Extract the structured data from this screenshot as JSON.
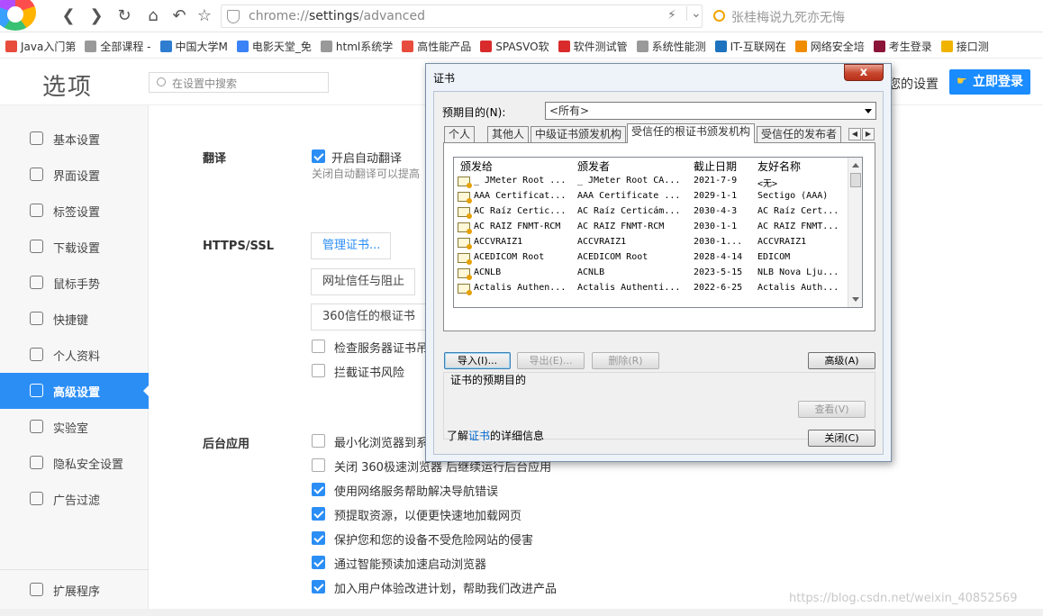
{
  "browser": {
    "url_prefix": "chrome://",
    "url_main": "settings",
    "url_suffix": "/advanced",
    "search_placeholder": "张桂梅说九死亦无悔",
    "bookmarks": [
      {
        "label": "Java入门第",
        "color": "#e84c3d"
      },
      {
        "label": "全部课程 -",
        "color": "#999999"
      },
      {
        "label": "中国大学M",
        "color": "#2e7dd1"
      },
      {
        "label": "电影天堂_免",
        "color": "#3b82f6"
      },
      {
        "label": "html系统学",
        "color": "#999999"
      },
      {
        "label": "高性能产品",
        "color": "#e84c3d"
      },
      {
        "label": "SPASVO软",
        "color": "#d92b2b"
      },
      {
        "label": "软件测试管",
        "color": "#d92b2b"
      },
      {
        "label": "系统性能测",
        "color": "#999999"
      },
      {
        "label": "IT-互联网在",
        "color": "#1e73be"
      },
      {
        "label": "网络安全培",
        "color": "#f08c00"
      },
      {
        "label": "考生登录",
        "color": "#8a1538"
      },
      {
        "label": "接口测",
        "color": "#f0b400"
      }
    ]
  },
  "settings": {
    "page_title": "选项",
    "search_placeholder": "在设置中搜索",
    "header_right_text": "您的设置",
    "login_label": "立即登录",
    "sidebar": [
      {
        "label": "基本设置",
        "icon": "gear-icon"
      },
      {
        "label": "界面设置",
        "icon": "window-icon"
      },
      {
        "label": "标签设置",
        "icon": "tab-icon"
      },
      {
        "label": "下载设置",
        "icon": "download-icon"
      },
      {
        "label": "鼠标手势",
        "icon": "mouse-icon"
      },
      {
        "label": "快捷键",
        "icon": "keyboard-icon"
      },
      {
        "label": "个人资料",
        "icon": "user-icon"
      },
      {
        "label": "高级设置",
        "icon": "wrench-icon",
        "active": true
      },
      {
        "label": "实验室",
        "icon": "flask-icon"
      },
      {
        "label": "隐私安全设置",
        "icon": "shield-icon"
      },
      {
        "label": "广告过滤",
        "icon": "block-icon"
      }
    ],
    "extensions_label": "扩展程序",
    "translate": {
      "title": "翻译",
      "option": "开启自动翻译",
      "hint": "关闭自动翻译可以提高"
    },
    "https": {
      "title": "HTTPS/SSL",
      "manage_cert": "管理证书...",
      "url_trust": "网址信任与阻止",
      "root_cert": "360信任的根证书",
      "check_server": "检查服务器证书吊销",
      "intercept": "拦截证书风险"
    },
    "background": {
      "title": "后台应用",
      "options": [
        {
          "label": "最小化浏览器到系统托盘",
          "checked": false
        },
        {
          "label": "关闭 360极速浏览器 后继续运行后台应用",
          "checked": false
        },
        {
          "label": "使用网络服务帮助解决导航错误",
          "checked": true
        },
        {
          "label": "预提取资源，以便更快速地加载网页",
          "checked": true
        },
        {
          "label": "保护您和您的设备不受危险网站的侵害",
          "checked": true
        },
        {
          "label": "通过智能预读加速启动浏览器",
          "checked": true
        },
        {
          "label": "加入用户体验改进计划，帮助我们改进产品",
          "checked": true
        }
      ]
    },
    "watermark": "https://blog.csdn.net/weixin_40852569"
  },
  "dialog": {
    "title": "证书",
    "close_glyph": "x",
    "purpose_label": "预期目的(N):",
    "purpose_value": "<所有>",
    "tabs": [
      "个人",
      "其他人",
      "中级证书颁发机构",
      "受信任的根证书颁发机构",
      "受信任的发布者"
    ],
    "active_tab_index": 3,
    "columns": [
      "颁发给",
      "颁发者",
      "截止日期",
      "友好名称"
    ],
    "rows": [
      [
        "_ JMeter Root ...",
        "_ JMeter Root CA...",
        "2021-7-9",
        "<无>"
      ],
      [
        "AAA Certificat...",
        "AAA Certificate ...",
        "2029-1-1",
        "Sectigo (AAA)"
      ],
      [
        "AC Raíz Certic...",
        "AC Raíz Certicám...",
        "2030-4-3",
        "AC Raíz Cert..."
      ],
      [
        "AC RAIZ FNMT-RCM",
        "AC RAIZ FNMT-RCM",
        "2030-1-1",
        "AC RAIZ FNMT..."
      ],
      [
        "ACCVRAIZ1",
        "ACCVRAIZ1",
        "2030-1...",
        "ACCVRAIZ1"
      ],
      [
        "ACEDICOM Root",
        "ACEDICOM Root",
        "2028-4-14",
        "EDICOM"
      ],
      [
        "ACNLB",
        "ACNLB",
        "2023-5-15",
        "NLB Nova Lju..."
      ],
      [
        "Actalis Authen...",
        "Actalis Authenti...",
        "2022-6-25",
        "Actalis Auth..."
      ]
    ],
    "import_label": "导入(I)...",
    "export_label": "导出(E)...",
    "remove_label": "删除(R)",
    "advanced_label": "高级(A)",
    "group_label": "证书的预期目的",
    "view_label": "查看(V)",
    "learn_prefix": "了解",
    "learn_link": "证书",
    "learn_suffix": "的详细信息",
    "close_label": "关闭(C)"
  }
}
